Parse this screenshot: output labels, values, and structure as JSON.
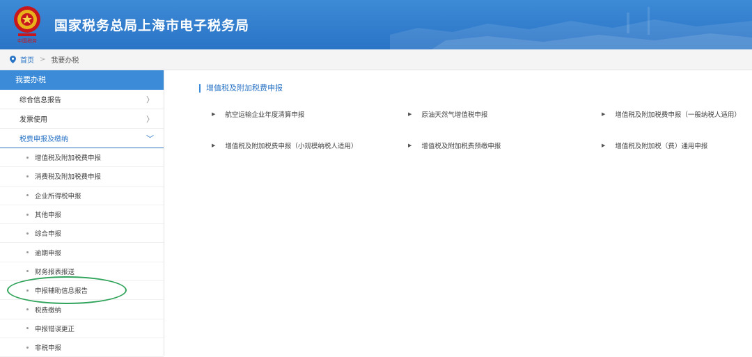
{
  "header": {
    "title": "国家税务总局上海市电子税务局",
    "emblem_icon": "tax-emblem-icon",
    "gradient_top": "#3d8ad6",
    "gradient_bottom": "#2a74c6"
  },
  "breadcrumb": {
    "icon": "location-pin-icon",
    "home": "首页",
    "current": "我要办税"
  },
  "sidebar": {
    "header": "我要办税",
    "items": [
      {
        "label": "综合信息报告",
        "chevron": "〉"
      },
      {
        "label": "发票使用",
        "chevron": "〉"
      },
      {
        "label": "税费申报及缴纳",
        "chevron": "﹀"
      }
    ],
    "sub_items": [
      "增值税及附加税费申报",
      "消费税及附加税费申报",
      "企业所得税申报",
      "其他申报",
      "综合申报",
      "逾期申报",
      "财务报表报送",
      "申报辅助信息报告",
      "税费缴纳",
      "申报错误更正",
      "非税申报"
    ],
    "accent_color": "#3b8bd8",
    "highlight_color": "#2fa35a"
  },
  "main": {
    "section_title": "增值税及附加税费申报",
    "links": [
      "航空运输企业年度清算申报",
      "原油天然气增值税申报",
      "增值税及附加税费申报（一般纳税人适用）",
      "增值税及附加税费申报（小规模纳税人适用）",
      "增值税及附加税费预缴申报",
      "增值税及附加税（费）通用申报"
    ],
    "link_arrow": "▶"
  }
}
